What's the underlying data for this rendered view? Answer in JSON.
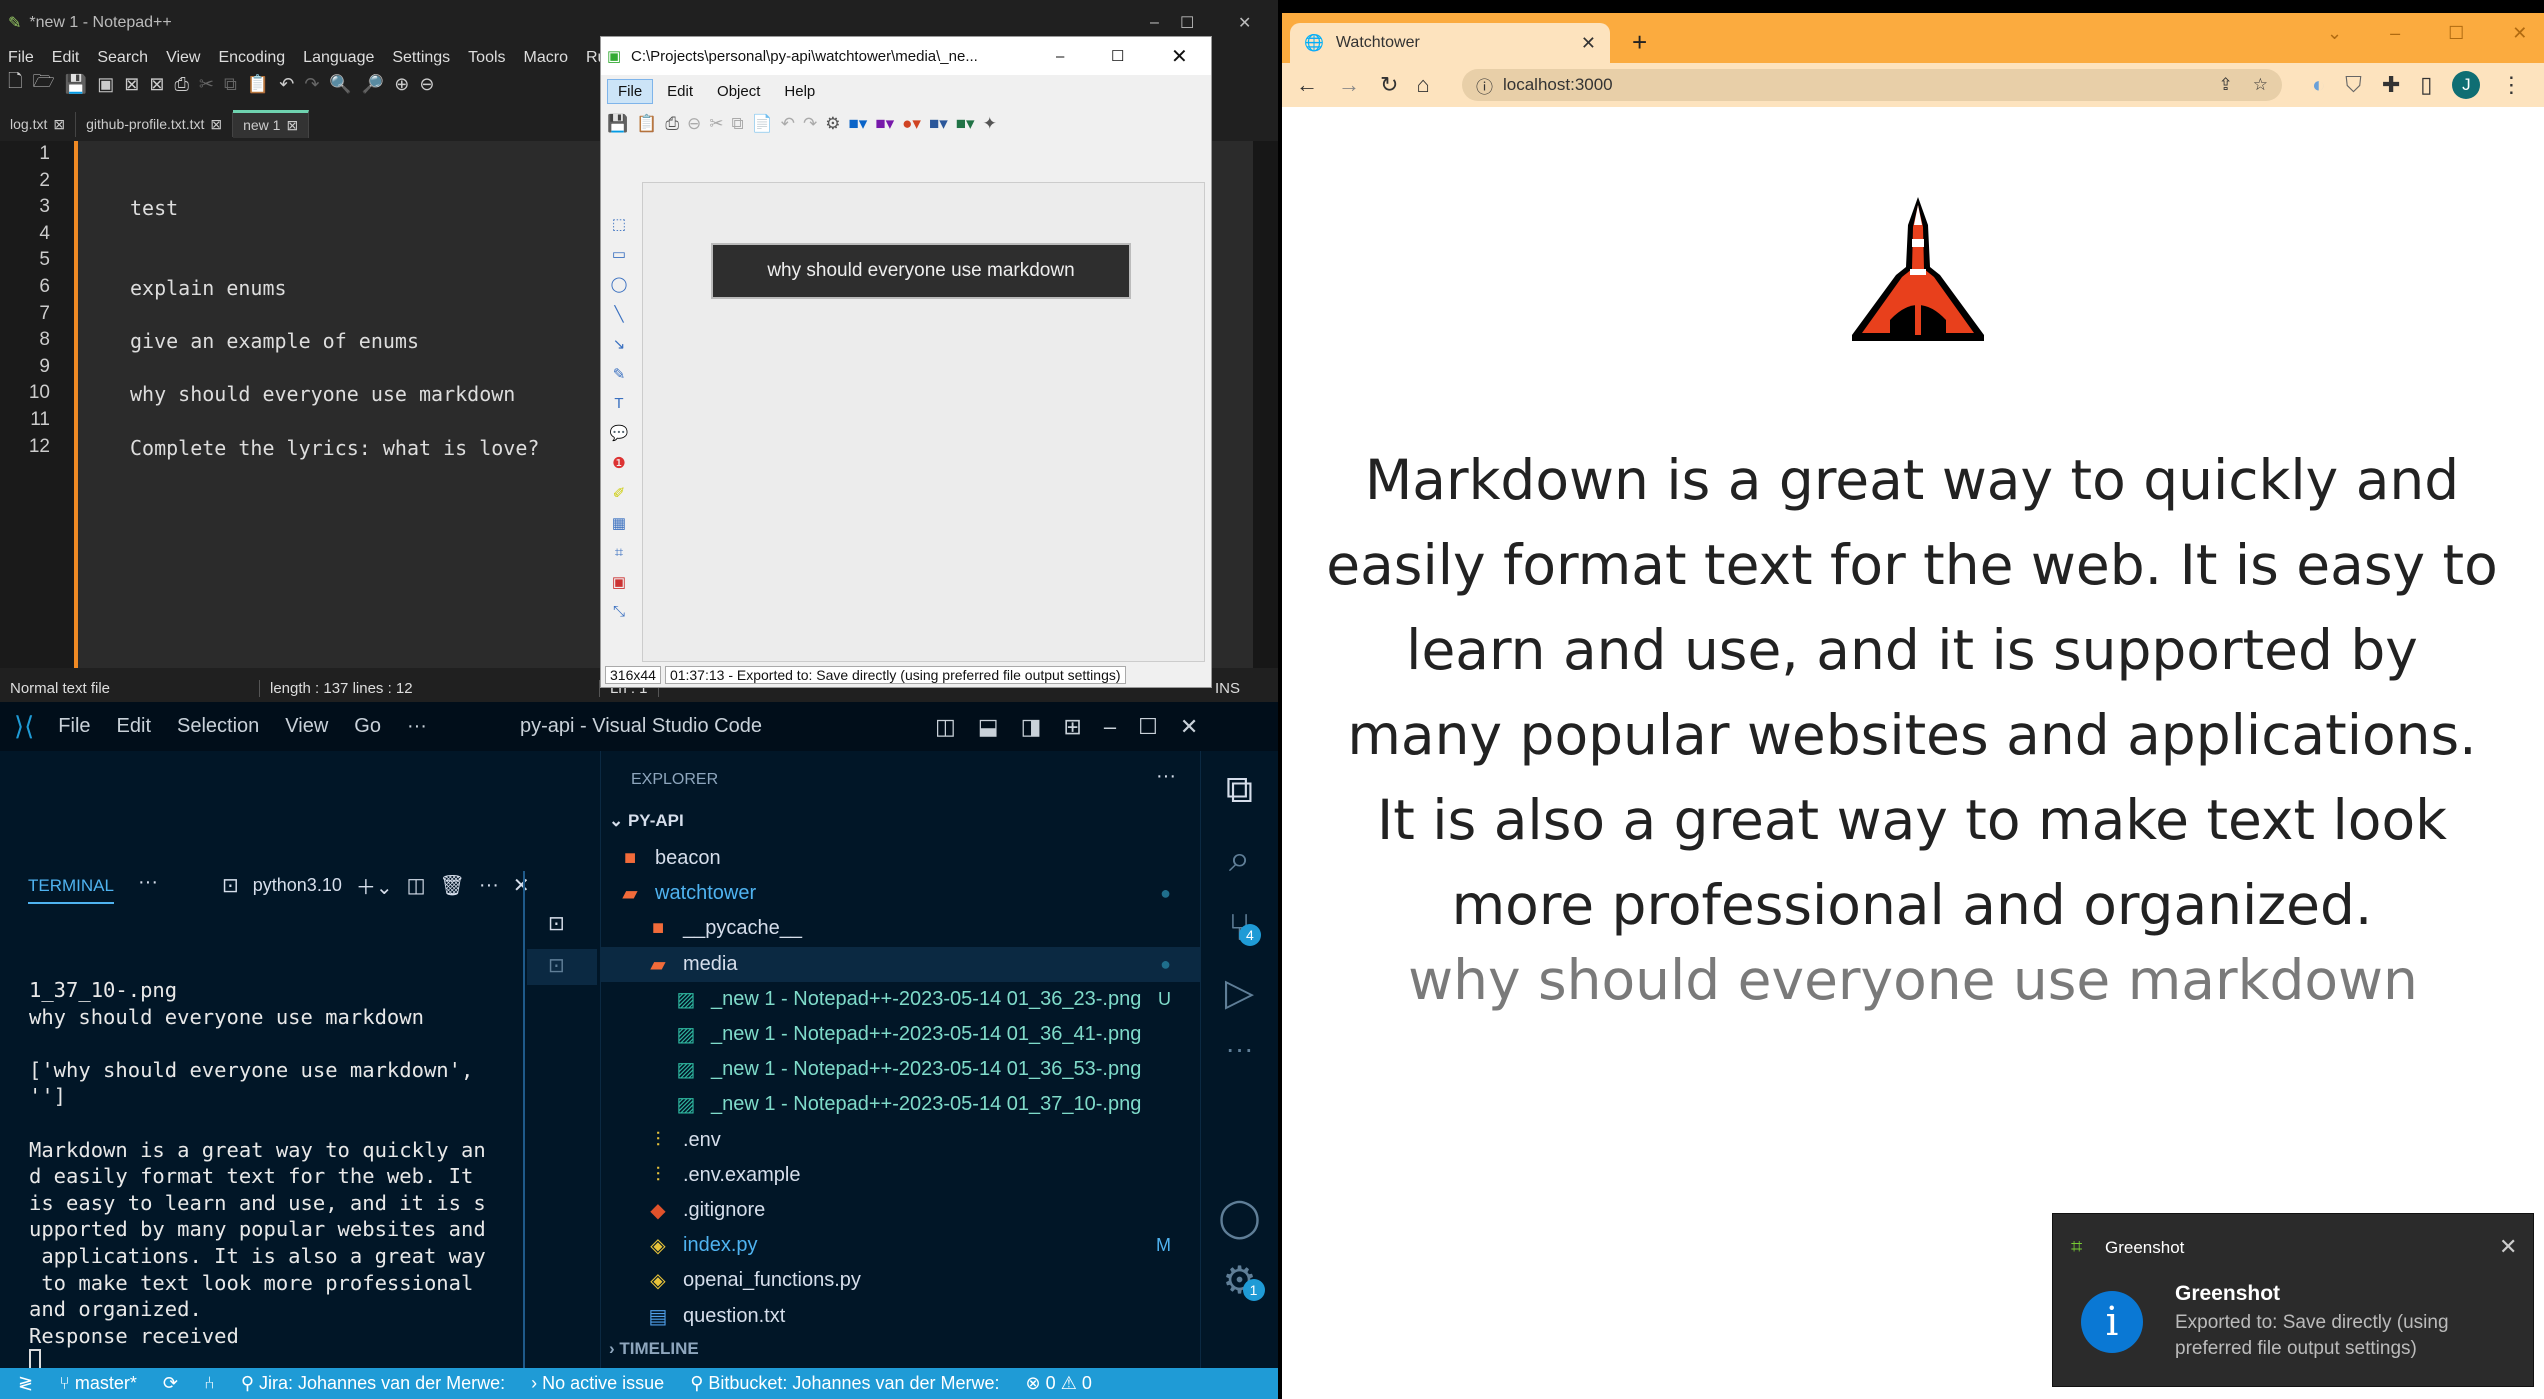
{
  "notepad": {
    "title": "*new 1 - Notepad++",
    "menu": [
      "File",
      "Edit",
      "Search",
      "View",
      "Encoding",
      "Language",
      "Settings",
      "Tools",
      "Macro",
      "Ru"
    ],
    "tabs": [
      "log.txt",
      "github-profile.txt.txt",
      "new 1"
    ],
    "lines": [
      "",
      "",
      "test",
      "",
      "",
      "explain enums",
      "",
      "give an example of enums",
      "",
      "why should everyone use markdown",
      "",
      "Complete the lyrics: what is love?"
    ],
    "status": {
      "type": "Normal text file",
      "length": "length : 137    lines : 12",
      "pos": "Ln : 1",
      "mode": "INS"
    }
  },
  "greenshot_editor": {
    "title": "C:\\Projects\\personal\\py-api\\watchtower\\media\\_ne...",
    "menu": [
      "File",
      "Edit",
      "Object",
      "Help"
    ],
    "capture_text": "why should everyone use markdown",
    "status_size": "316x44",
    "status_msg": "01:37:13 - Exported to: Save directly (using preferred file output settings)"
  },
  "vscode": {
    "menu": [
      "File",
      "Edit",
      "Selection",
      "View",
      "Go",
      "···"
    ],
    "title": "py-api - Visual Studio Code",
    "terminal": {
      "tab": "TERMINAL",
      "shell": "python3.10",
      "lines": [
        "1_37_10-.png",
        "why should everyone use markdown",
        "",
        "['why should everyone use markdown',",
        "'']",
        "",
        "Markdown is a great way to quickly an",
        "d easily format text for the web. It",
        "is easy to learn and use, and it is s",
        "upported by many popular websites and",
        " applications. It is also a great way",
        " to make text look more professional",
        "and organized.",
        "Response received"
      ]
    },
    "explorer": {
      "header": "EXPLORER",
      "root": "PY-API",
      "timeline": "TIMELINE",
      "items": [
        {
          "name": "beacon",
          "icon": "folder-icon",
          "depth": 0,
          "color": "#d6deeb"
        },
        {
          "name": "watchtower",
          "icon": "folder-open-icon",
          "depth": 0,
          "color": "#4fb3f0",
          "badge": "●"
        },
        {
          "name": "__pycache__",
          "icon": "folder-icon",
          "depth": 1,
          "color": "#d6deeb"
        },
        {
          "name": "media",
          "icon": "folder-open-icon",
          "depth": 1,
          "color": "#d6deeb",
          "badge": "●",
          "selected": true
        },
        {
          "name": "_new 1 - Notepad++-2023-05-14 01_36_23-.png",
          "icon": "image-file-icon",
          "depth": 2,
          "color": "#7fdbca",
          "badge": "U"
        },
        {
          "name": "_new 1 - Notepad++-2023-05-14 01_36_41-.png",
          "icon": "image-file-icon",
          "depth": 2,
          "color": "#7fdbca"
        },
        {
          "name": "_new 1 - Notepad++-2023-05-14 01_36_53-.png",
          "icon": "image-file-icon",
          "depth": 2,
          "color": "#7fdbca"
        },
        {
          "name": "_new 1 - Notepad++-2023-05-14 01_37_10-.png",
          "icon": "image-file-icon",
          "depth": 2,
          "color": "#7fdbca"
        },
        {
          "name": ".env",
          "icon": "settings-file-icon",
          "depth": 1,
          "color": "#d6deeb"
        },
        {
          "name": ".env.example",
          "icon": "settings-file-icon",
          "depth": 1,
          "color": "#d6deeb"
        },
        {
          "name": ".gitignore",
          "icon": "git-icon",
          "depth": 1,
          "color": "#d6deeb"
        },
        {
          "name": "index.py",
          "icon": "python-icon",
          "depth": 1,
          "color": "#4fb3f0",
          "badge": "M"
        },
        {
          "name": "openai_functions.py",
          "icon": "python-icon",
          "depth": 1,
          "color": "#d6deeb"
        },
        {
          "name": "question.txt",
          "icon": "text-file-icon",
          "depth": 1,
          "color": "#d6deeb"
        }
      ]
    },
    "scm_badge": "4",
    "settings_badge": "1",
    "status": {
      "branch": "master*",
      "jira": "Jira: Johannes van der Merwe:",
      "issue": "No active issue",
      "bitbucket": "Bitbucket: Johannes van der Merwe:",
      "errors": "0",
      "warnings": "0"
    }
  },
  "browser": {
    "tab_title": "Watchtower",
    "url": "localhost:3000",
    "profile": "J",
    "accent": "#fbab3f",
    "answer": "Markdown is a great way to quickly and easily format text for the web. It is easy to learn and use, and it is supported by many popular websites and applications. It is also a great way to make text look more professional and organized.",
    "question": "why should everyone use markdown"
  },
  "toast": {
    "app": "Greenshot",
    "title": "Greenshot",
    "message": "Exported to: Save directly (using preferred file output settings)"
  }
}
